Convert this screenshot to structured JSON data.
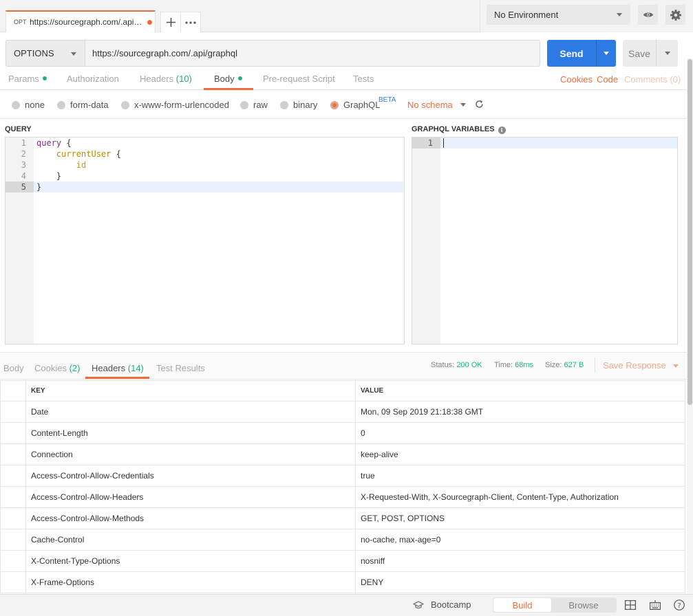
{
  "tab": {
    "method_abbr": "OPT",
    "url": "https://sourcegraph.com/.api/graphql"
  },
  "environment": {
    "selected": "No Environment"
  },
  "request": {
    "method": "OPTIONS",
    "url": "https://sourcegraph.com/.api/graphql",
    "send_label": "Send",
    "save_label": "Save"
  },
  "request_tabs": {
    "params": "Params",
    "authorization": "Authorization",
    "headers": "Headers",
    "headers_count": "(10)",
    "body": "Body",
    "prerequest": "Pre-request Script",
    "tests": "Tests",
    "cookies": "Cookies",
    "code": "Code",
    "comments": "Comments (0)"
  },
  "body_types": {
    "none": "none",
    "form_data": "form-data",
    "urlencoded": "x-www-form-urlencoded",
    "raw": "raw",
    "binary": "binary",
    "graphql": "GraphQL",
    "beta": "BETA",
    "schema": "No schema"
  },
  "query": {
    "title": "QUERY",
    "lines": [
      {
        "n": "1",
        "t1": "query",
        "t2": " {"
      },
      {
        "n": "2",
        "t1": "    currentUser",
        "t2": " {"
      },
      {
        "n": "3",
        "t1": "        id",
        "t2": ""
      },
      {
        "n": "4",
        "t1": "    }",
        "t2": ""
      },
      {
        "n": "5",
        "t1": "}",
        "t2": ""
      }
    ]
  },
  "variables": {
    "title": "GRAPHQL VARIABLES",
    "line_number": "1"
  },
  "response": {
    "tabs": {
      "body": "Body",
      "cookies": "Cookies",
      "cookies_count": "(2)",
      "headers": "Headers",
      "headers_count": "(14)",
      "test_results": "Test Results"
    },
    "status_label": "Status:",
    "status_value": "200 OK",
    "time_label": "Time:",
    "time_value": "68ms",
    "size_label": "Size:",
    "size_value": "627 B",
    "save_response": "Save Response",
    "table_headers": {
      "key": "KEY",
      "value": "VALUE"
    },
    "headers": [
      {
        "key": "Date",
        "value": "Mon, 09 Sep 2019 21:18:38 GMT"
      },
      {
        "key": "Content-Length",
        "value": "0"
      },
      {
        "key": "Connection",
        "value": "keep-alive"
      },
      {
        "key": "Access-Control-Allow-Credentials",
        "value": "true"
      },
      {
        "key": "Access-Control-Allow-Headers",
        "value": "X-Requested-With, X-Sourcegraph-Client, Content-Type, Authorization"
      },
      {
        "key": "Access-Control-Allow-Methods",
        "value": "GET, POST, OPTIONS"
      },
      {
        "key": "Cache-Control",
        "value": "no-cache, max-age=0"
      },
      {
        "key": "X-Content-Type-Options",
        "value": "nosniff"
      },
      {
        "key": "X-Frame-Options",
        "value": "DENY"
      }
    ]
  },
  "footer": {
    "bootcamp": "Bootcamp",
    "build": "Build",
    "browse": "Browse"
  },
  "colors": {
    "accent": "#f26b3a",
    "primary": "#2d7ae5",
    "success": "#21b27a"
  }
}
